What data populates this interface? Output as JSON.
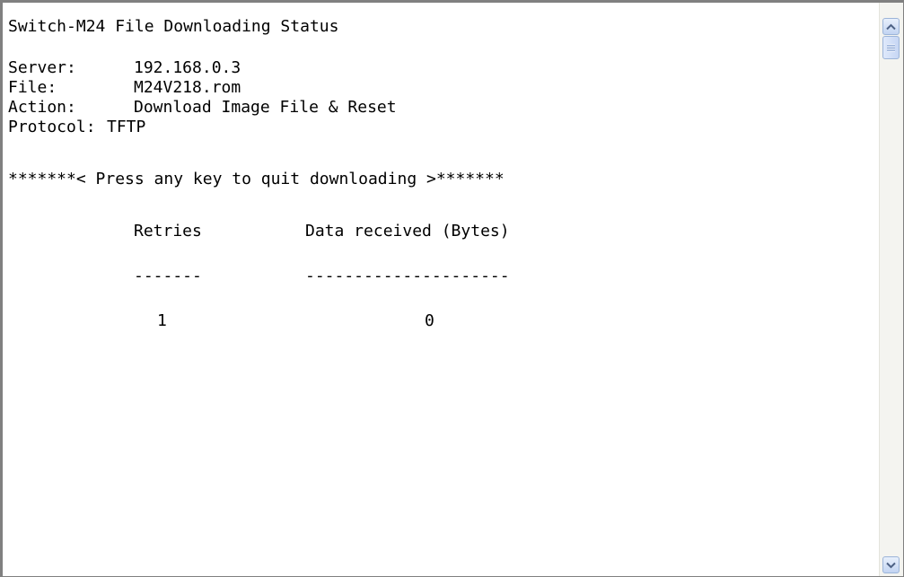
{
  "terminal": {
    "title": "Switch-M24 File Downloading Status",
    "server_label": "Server:",
    "server_value": "192.168.0.3",
    "file_label": "File:",
    "file_value": "M24V218.rom",
    "action_label": "Action:",
    "action_value": "Download Image File & Reset",
    "protocol_label": "Protocol:",
    "protocol_value": "TFTP",
    "prompt": "*******< Press any key to quit downloading >*******",
    "table": {
      "headers": [
        "Retries",
        "Data received (Bytes)"
      ],
      "separators": [
        "-------",
        "---------------------"
      ],
      "rows": [
        [
          "1",
          "0"
        ]
      ]
    }
  },
  "scrollbar": {
    "up_icon": "arrow-up-icon",
    "down_icon": "arrow-down-icon",
    "thumb_icon": "grip-icon"
  }
}
